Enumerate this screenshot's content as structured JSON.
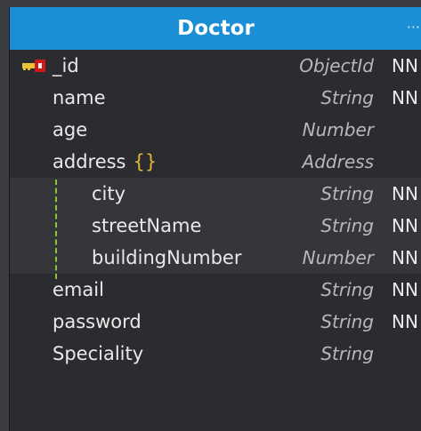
{
  "entity": {
    "title": "Doctor",
    "menu_glyph": "···",
    "fields": [
      {
        "name": "_id",
        "type": "ObjectId",
        "nn": "NN",
        "pk_icon": "key-icon"
      },
      {
        "name": "name",
        "type": "String",
        "nn": "NN"
      },
      {
        "name": "age",
        "type": "Number",
        "nn": ""
      },
      {
        "name": "address",
        "type": "Address",
        "nn": "",
        "braces": "{}"
      },
      {
        "name": "city",
        "type": "String",
        "nn": "NN"
      },
      {
        "name": "streetName",
        "type": "String",
        "nn": "NN"
      },
      {
        "name": "buildingNumber",
        "type": "Number",
        "nn": "NN"
      },
      {
        "name": "email",
        "type": "String",
        "nn": "NN"
      },
      {
        "name": "password",
        "type": "String",
        "nn": "NN"
      },
      {
        "name": "Speciality",
        "type": "String",
        "nn": ""
      }
    ]
  },
  "colors": {
    "header": "#1a8fd6",
    "body": "#2a2c2f",
    "subdoc_row": "#34363a",
    "braces": "#e2b43c",
    "subdoc_line": "#8fc33b"
  }
}
